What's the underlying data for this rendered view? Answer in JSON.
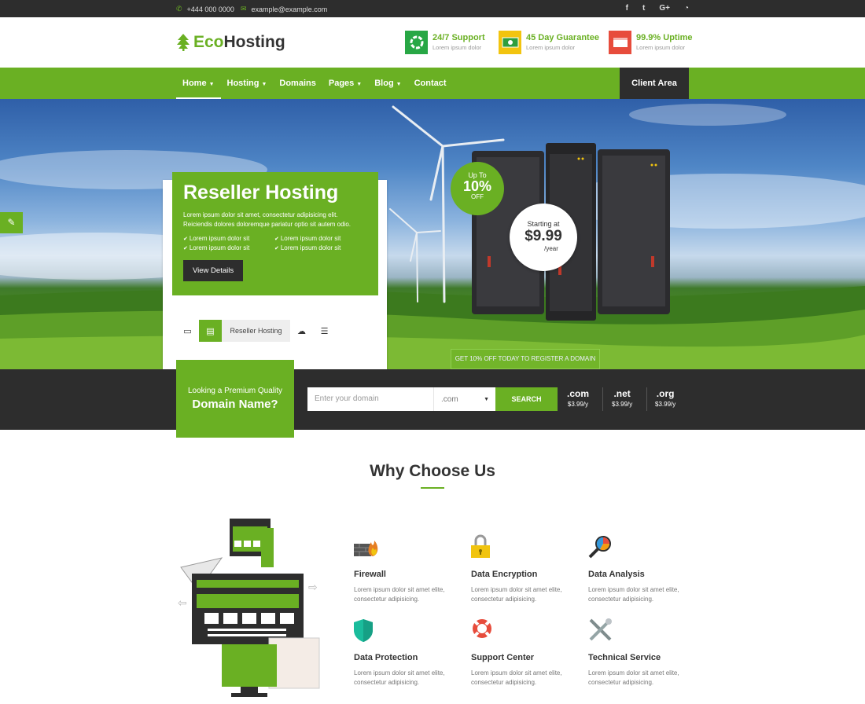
{
  "topbar": {
    "phone": "+444 000 0000",
    "email": "example@example.com",
    "social": [
      "f",
      "t",
      "G+",
      "rss"
    ]
  },
  "header": {
    "logo_eco": "Eco",
    "logo_hosting": "Hosting",
    "features": [
      {
        "title": "24/7 Support",
        "subtitle": "Lorem ipsum dolor",
        "icon": "support-icon",
        "color": "#28a745"
      },
      {
        "title": "45 Day Guarantee",
        "subtitle": "Lorem ipsum dolor",
        "icon": "money-icon",
        "color": "#f2c40f"
      },
      {
        "title": "99.9% Uptime",
        "subtitle": "Lorem ipsum dolor",
        "icon": "uptime-icon",
        "color": "#e74c3c"
      }
    ]
  },
  "nav": {
    "items": [
      {
        "label": "Home",
        "dropdown": true
      },
      {
        "label": "Hosting",
        "dropdown": true
      },
      {
        "label": "Domains",
        "dropdown": false
      },
      {
        "label": "Pages",
        "dropdown": true
      },
      {
        "label": "Blog",
        "dropdown": true
      },
      {
        "label": "Contact",
        "dropdown": false
      }
    ],
    "client_area": "Client Area"
  },
  "hero": {
    "title": "Reseller Hosting",
    "description": "Lorem ipsum dolor sit amet, consectetur adipisicing elit. Reiciendis dolores doloremque pariatur optio sit autem odio.",
    "features": [
      "Lorem ipsum dolor sit",
      "Lorem ipsum dolor sit",
      "Lorem ipsum dolor sit",
      "Lorem ipsum dolor sit"
    ],
    "button": "View Details",
    "discount": {
      "prefix": "Up To",
      "value": "10%",
      "suffix": "OFF"
    },
    "price": {
      "prefix": "Starting at",
      "value": "$9.99",
      "suffix": "/year"
    },
    "tab_label": "Reseller Hosting",
    "tab_icons": [
      "laptop-icon",
      "server-icon",
      "cloud-icon",
      "dedicated-icon"
    ],
    "domain_tag": "GET 10% OFF TODAY TO REGISTER A DOMAIN"
  },
  "domain": {
    "label_small": "Looking a Premium Quality",
    "label_big": "Domain Name?",
    "placeholder": "Enter your domain",
    "selected_tld": ".com",
    "search_label": "SEARCH",
    "tlds": [
      {
        "name": ".com",
        "price": "$3.99/y"
      },
      {
        "name": ".net",
        "price": "$3.99/y"
      },
      {
        "name": ".org",
        "price": "$3.99/y"
      }
    ]
  },
  "why": {
    "title": "Why Choose Us",
    "services": [
      {
        "title": "Firewall",
        "desc": "Lorem ipsum dolor sit amet elite, consectetur adipisicing.",
        "icon": "firewall-icon"
      },
      {
        "title": "Data Encryption",
        "desc": "Lorem ipsum dolor sit amet elite, consectetur adipisicing.",
        "icon": "lock-icon"
      },
      {
        "title": "Data Analysis",
        "desc": "Lorem ipsum dolor sit amet elite, consectetur adipisicing.",
        "icon": "analysis-icon"
      },
      {
        "title": "Data Protection",
        "desc": "Lorem ipsum dolor sit amet elite, consectetur adipisicing.",
        "icon": "shield-icon"
      },
      {
        "title": "Support Center",
        "desc": "Lorem ipsum dolor sit amet elite, consectetur adipisicing.",
        "icon": "lifebuoy-icon"
      },
      {
        "title": "Technical Service",
        "desc": "Lorem ipsum dolor sit amet elite, consectetur adipisicing.",
        "icon": "tools-icon"
      }
    ]
  },
  "colors": {
    "accent": "#6ab023",
    "dark": "#2d2d2d"
  }
}
